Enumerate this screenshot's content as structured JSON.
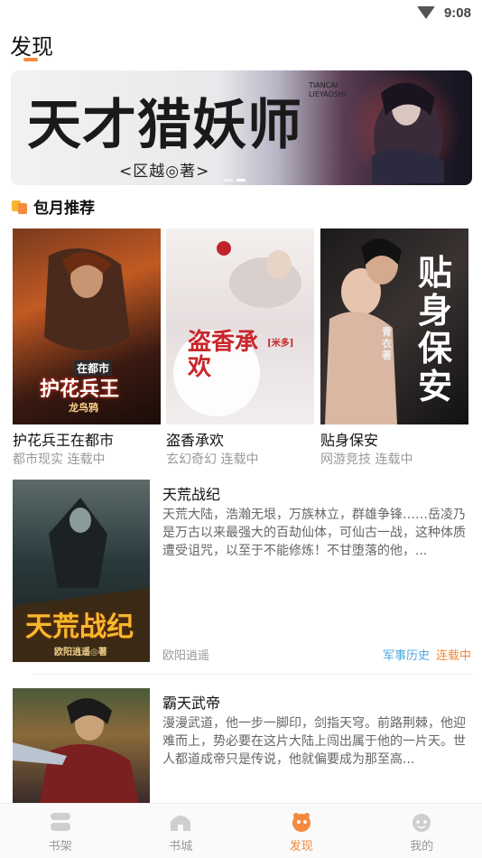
{
  "status_bar": {
    "time": "9:08"
  },
  "header": {
    "title": "发现"
  },
  "banner": {
    "title": "天才猎妖师",
    "author_line": "<区越◎著>",
    "english_line": "TIANCAI LIEYAOSHI",
    "slides_total": 2,
    "active_slide": 2
  },
  "section": {
    "title": "包月推荐"
  },
  "grid_books": [
    {
      "title": "护花兵王在都市",
      "meta": "都市现实 连载中",
      "cover_text": "护花兵王",
      "cover_sub": "在都市",
      "cover_author": "龙鸟鸦"
    },
    {
      "title": "盗香承欢",
      "meta": "玄幻奇幻 连载中",
      "cover_text": "盗香承欢",
      "cover_sub": "[米多]",
      "cover_author": ""
    },
    {
      "title": "贴身保安",
      "meta": "网游竞技 连载中",
      "cover_text": "贴身保安",
      "cover_sub": "青衣著",
      "cover_author": ""
    }
  ],
  "list_books": [
    {
      "title": "天荒战纪",
      "desc": "天荒大陆，浩瀚无垠，万族林立，群雄争锋……岳凌乃是万古以来最强大的百劫仙体，可仙古一战，这种体质遭受诅咒，以至于不能修炼！不甘堕落的他，...",
      "author": "欧阳逍遥",
      "category": "军事历史",
      "status": "连载中",
      "cover_text": "天荒战纪",
      "cover_author": "欧阳逍遥◎著"
    },
    {
      "title": "霸天武帝",
      "desc": "漫漫武道，他一步一脚印，剑指天穹。前路荆棘，他迎难而上，势必要在这片大陆上闯出属于他的一片天。世人都道成帝只是传说，他就偏要成为那至高...",
      "author": "",
      "category": "",
      "status": "",
      "cover_text": "",
      "cover_author": ""
    }
  ],
  "tabs": [
    {
      "label": "书架",
      "icon": "bookshelf-icon"
    },
    {
      "label": "书城",
      "icon": "bookstore-icon"
    },
    {
      "label": "发现",
      "icon": "discover-icon",
      "active": true
    },
    {
      "label": "我的",
      "icon": "profile-icon"
    }
  ],
  "colors": {
    "accent": "#f5893c",
    "category": "#4aa8e0"
  }
}
